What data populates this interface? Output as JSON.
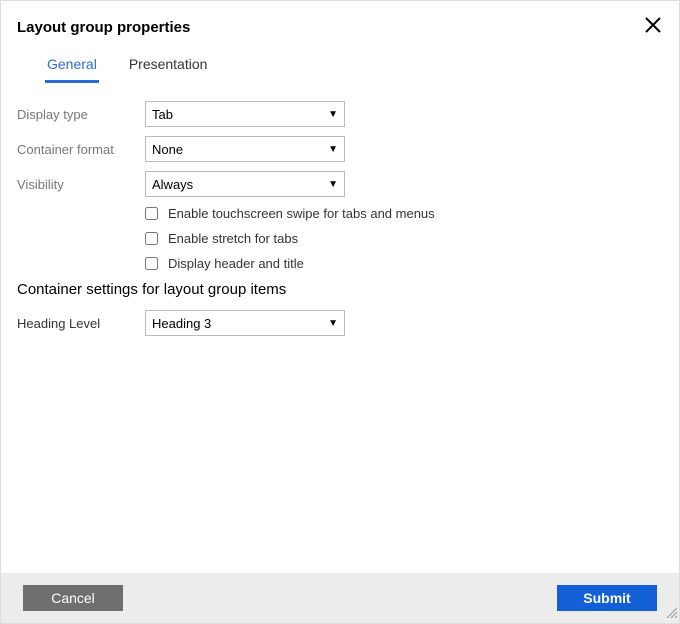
{
  "dialog": {
    "title": "Layout group properties"
  },
  "tabs": {
    "general": "General",
    "presentation": "Presentation"
  },
  "labels": {
    "displayType": "Display type",
    "containerFormat": "Container format",
    "visibility": "Visibility",
    "headingLevel": "Heading Level"
  },
  "selects": {
    "displayType": "Tab",
    "containerFormat": "None",
    "visibility": "Always",
    "headingLevel": "Heading 3"
  },
  "checkboxes": {
    "swipe": "Enable touchscreen swipe for tabs and menus",
    "stretch": "Enable stretch for tabs",
    "headerTitle": "Display header and title"
  },
  "sections": {
    "containerSettings": "Container settings for layout group items"
  },
  "buttons": {
    "cancel": "Cancel",
    "submit": "Submit"
  }
}
